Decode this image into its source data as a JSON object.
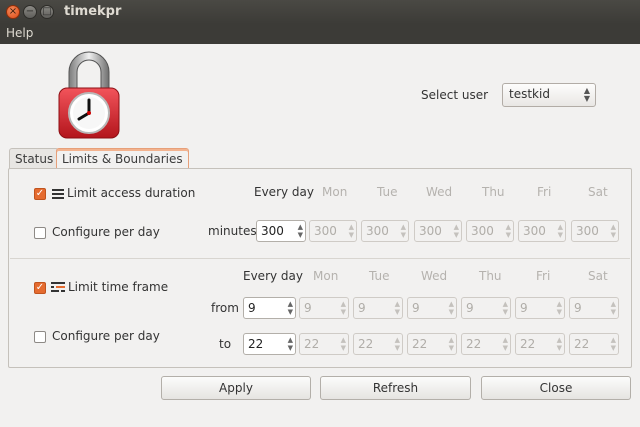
{
  "window": {
    "title": "timekpr"
  },
  "menu": {
    "help": "Help"
  },
  "user": {
    "label": "Select user",
    "selected": "testkid"
  },
  "tabs": [
    {
      "label": "Status"
    },
    {
      "label": "Limits & Boundaries"
    }
  ],
  "duration": {
    "label": "Limit access duration",
    "checked": true,
    "configure_label": "Configure per day",
    "unit_label": "minutes",
    "days": [
      "Every day",
      "Mon",
      "Tue",
      "Wed",
      "Thu",
      "Fri",
      "Sat"
    ],
    "values": [
      "300",
      "300",
      "300",
      "300",
      "300",
      "300",
      "300"
    ]
  },
  "timeframe": {
    "label": "Limit time frame",
    "checked": true,
    "configure_label": "Configure per day",
    "from_label": "from",
    "to_label": "to",
    "days": [
      "Every day",
      "Mon",
      "Tue",
      "Wed",
      "Thu",
      "Fri",
      "Sat"
    ],
    "from_values": [
      "9",
      "9",
      "9",
      "9",
      "9",
      "9",
      "9"
    ],
    "to_values": [
      "22",
      "22",
      "22",
      "22",
      "22",
      "22",
      "22"
    ]
  },
  "buttons": {
    "apply": "Apply",
    "refresh": "Refresh",
    "close": "Close"
  },
  "colors": {
    "accent": "#e56b2f",
    "lock_body": "#d9262c",
    "titlebar": "#3c3b37"
  }
}
